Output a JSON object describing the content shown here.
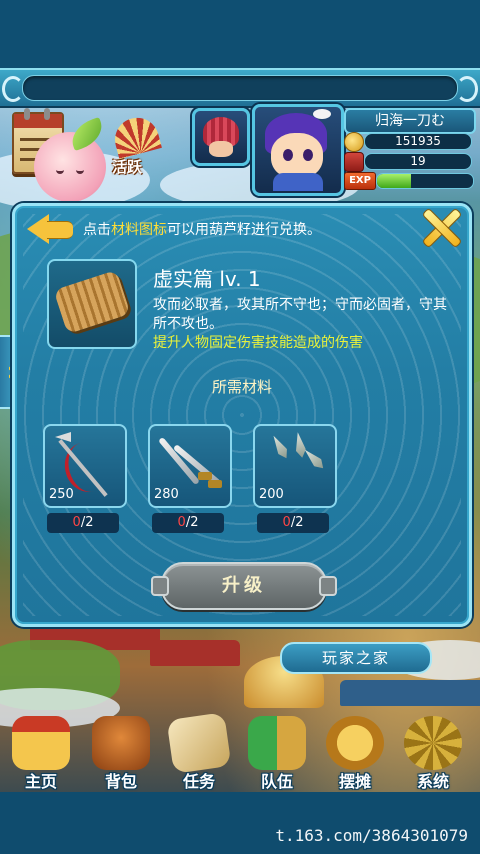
{
  "hud": {
    "activity_label": "活跃",
    "player_name": "归海一刀む",
    "coins": "151935",
    "bag_count": "19",
    "exp_label": "EXP",
    "exp_progress": 0.35
  },
  "dialog": {
    "hint_prefix": "点击",
    "hint_highlight": "材料图标",
    "hint_suffix": "可以用葫芦籽进行兑换。",
    "skill_name": "虚实篇 lv. 1",
    "skill_description": "攻而必取者，攻其所不守也；守而必固者，守其所不攻也。",
    "skill_effect": "提升人物固定伤害技能造成的伤害",
    "materials_title": "所需材料",
    "materials": [
      {
        "name": "spear",
        "value": "250",
        "have": "0",
        "need": "/2"
      },
      {
        "name": "twin-swords",
        "value": "280",
        "have": "0",
        "need": "/2"
      },
      {
        "name": "darts",
        "value": "200",
        "have": "0",
        "need": "/2"
      }
    ],
    "upgrade_label": "升级"
  },
  "home_sign": "玩家之家",
  "nav": [
    {
      "label": "主页",
      "icon": "home-icon"
    },
    {
      "label": "背包",
      "icon": "backpack-icon"
    },
    {
      "label": "任务",
      "icon": "quest-scroll-icon"
    },
    {
      "label": "队伍",
      "icon": "team-icon"
    },
    {
      "label": "摆摊",
      "icon": "stall-icon"
    },
    {
      "label": "系统",
      "icon": "system-gear-icon"
    }
  ],
  "watermark": "t.163.com/3864301079",
  "colors": {
    "dialog_bg": "#2a8db4",
    "highlight": "#ffde36",
    "effect_text": "#e9f23a",
    "missing_count": "#ff4545"
  }
}
